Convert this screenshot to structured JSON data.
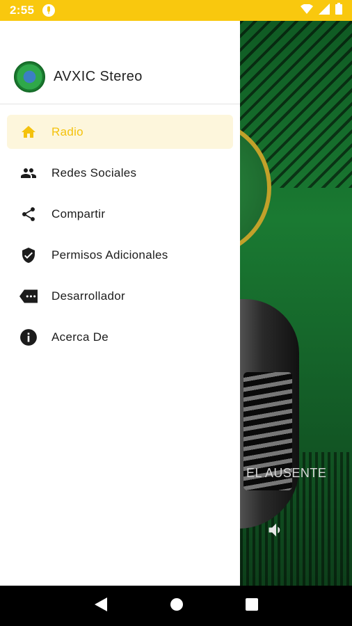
{
  "status_bar": {
    "time": "2:55",
    "mic_icon": "mic-icon",
    "wifi_icon": "wifi-icon",
    "signal_icon": "signal-icon",
    "battery_icon": "battery-icon"
  },
  "drawer": {
    "app_name": "AVXIC Stereo",
    "items": [
      {
        "label": "Radio",
        "icon": "home-icon",
        "active": true
      },
      {
        "label": "Redes Sociales",
        "icon": "people-icon",
        "active": false
      },
      {
        "label": "Compartir",
        "icon": "share-icon",
        "active": false
      },
      {
        "label": "Permisos Adicionales",
        "icon": "shield-icon",
        "active": false
      },
      {
        "label": "Desarrollador",
        "icon": "label-tag-icon",
        "active": false
      },
      {
        "label": "Acerca De",
        "icon": "info-icon",
        "active": false
      }
    ]
  },
  "player": {
    "song_title": "EL AUSENTE",
    "volume_icon": "volume-icon"
  },
  "colors": {
    "accent": "#f9c80e",
    "active_bg": "#fdf6dc",
    "background_green": "#1a7a32"
  },
  "nav_bar": {
    "back_icon": "back-icon",
    "home_icon": "home-circle-icon",
    "recents_icon": "recents-icon"
  }
}
